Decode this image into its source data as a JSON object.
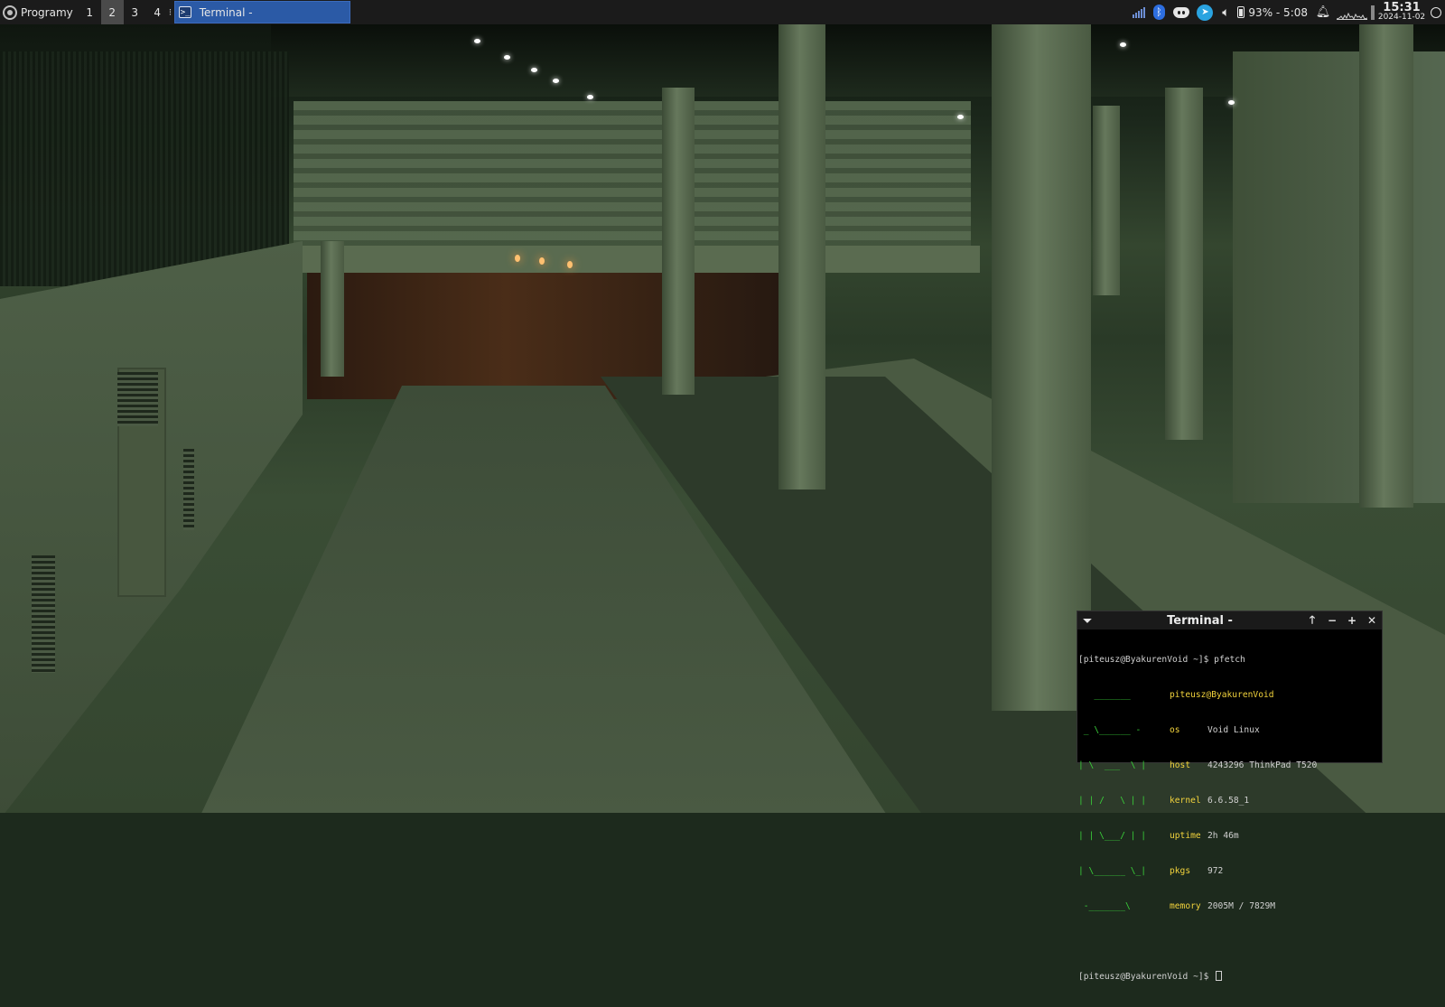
{
  "panel": {
    "menu_label": "Programy",
    "workspaces": [
      "1",
      "2",
      "3",
      "4"
    ],
    "active_workspace": "2",
    "separator": "⁝",
    "task_title": "Terminal -",
    "task_icon_glyph": ">_",
    "battery_text": "93% - 5:08",
    "clock_time": "15:31",
    "clock_date": "2024-11-02",
    "tray_icons": [
      "network-signal-icon",
      "bluetooth-icon",
      "discord-icon",
      "telegram-icon",
      "volume-icon",
      "battery-icon",
      "notification-bell-icon",
      "cpu-graph-icon",
      "logout-icon"
    ]
  },
  "terminal": {
    "title": "Terminal -",
    "prompt1": "[piteusz@ByakurenVoid ~]$ pfetch",
    "header": "piteusz@ByakurenVoid",
    "logo": [
      "   _______    ",
      " _ \\______ -  ",
      "| \\  ___  \\ | ",
      "| | /   \\ | | ",
      "| | \\___/ | | ",
      "| \\______ \\_| ",
      " -_______\\    "
    ],
    "info": [
      {
        "key": "os",
        "value": "Void Linux"
      },
      {
        "key": "host",
        "value": "4243296 ThinkPad T520"
      },
      {
        "key": "kernel",
        "value": "6.6.58_1"
      },
      {
        "key": "uptime",
        "value": "2h 46m"
      },
      {
        "key": "pkgs",
        "value": "972"
      },
      {
        "key": "memory",
        "value": "2005M / 7829M"
      }
    ],
    "prompt2": "[piteusz@ByakurenVoid ~]$ "
  },
  "colors": {
    "panel_bg": "#1b1b1b",
    "task_active": "#2b5aa6",
    "terminal_green": "#3ad13a",
    "terminal_yellow": "#f2d33c"
  }
}
